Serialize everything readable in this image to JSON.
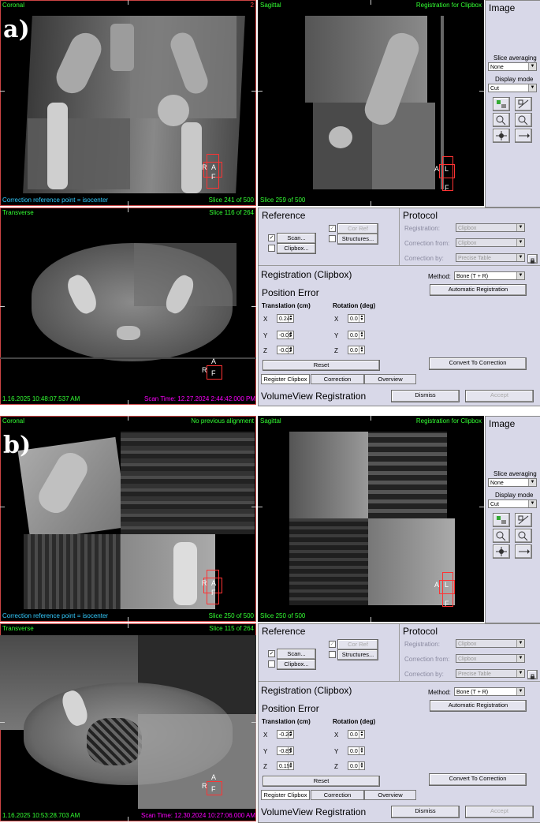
{
  "panels": [
    {
      "letter": "a)",
      "coronal": {
        "title": "Coronal",
        "right": "2",
        "bottom_left": "Correction reference point = isocenter",
        "bottom_right": "Slice 241 of 500"
      },
      "sagittal": {
        "title": "Sagittal",
        "right": "Registration for Clipbox",
        "bottom_left": "Slice 259 of 500"
      },
      "transverse": {
        "title": "Transverse",
        "right": "Slice 116 of 264",
        "bottom_left": "1.16.2025 10:48:07.537 AM",
        "bottom_right": "Scan Time: 12.27.2024 2:44:42.000 PM"
      },
      "translation": {
        "x": "0.24",
        "y": "-0.06",
        "z": "-0.03"
      },
      "rotation": {
        "x": "0.0",
        "y": "0.0",
        "z": "0.0"
      }
    },
    {
      "letter": "b)",
      "coronal": {
        "title": "Coronal",
        "right": "No previous alignment",
        "bottom_left": "Correction reference point = isocenter",
        "bottom_right": "Slice 250 of 500"
      },
      "sagittal": {
        "title": "Sagittal",
        "right": "Registration for Clipbox",
        "bottom_left": "Slice 250 of 500"
      },
      "transverse": {
        "title": "Transverse",
        "right": "Slice 115 of 264",
        "bottom_left": "1.16.2025 10:53:28.703 AM",
        "bottom_right": "Scan Time: 12.30.2024 10:27:06.000 AM"
      },
      "translation": {
        "x": "-0.20",
        "y": "-0.85",
        "z": "0.15"
      },
      "rotation": {
        "x": "0.0",
        "y": "0.0",
        "z": "0.0"
      }
    }
  ],
  "orient": {
    "coronal": [
      "R",
      "A",
      "F"
    ],
    "sagittal": [
      "A",
      "L",
      "F"
    ],
    "transverse": [
      "A",
      "R",
      "F"
    ]
  },
  "image_panel": {
    "title": "Image",
    "slice_avg_label": "Slice averaging",
    "slice_avg_value": "None",
    "display_mode_label": "Display mode",
    "display_mode_value": "Cut"
  },
  "reference": {
    "title": "Reference",
    "scan": "Scan...",
    "clipbox": "Clipbox...",
    "corref": "Cor Ref",
    "structures": "Structures..."
  },
  "protocol": {
    "title": "Protocol",
    "registration_label": "Registration:",
    "registration_value": "Clipbox",
    "correction_from_label": "Correction from:",
    "correction_from_value": "Clipbox",
    "correction_by_label": "Correction by:",
    "correction_by_value": "Precise Table"
  },
  "registration": {
    "title": "Registration (Clipbox)",
    "method_label": "Method:",
    "method_value": "Bone (T + R)",
    "auto_btn": "Automatic Registration",
    "position_error": "Position Error",
    "translation_label": "Translation (cm)",
    "rotation_label": "Rotation (deg)",
    "x": "X",
    "y": "Y",
    "z": "Z",
    "reset": "Reset",
    "convert": "Convert To Correction"
  },
  "tabs": [
    "Register Clipbox",
    "Correction",
    "Overview"
  ],
  "footer": {
    "title": "VolumeView Registration",
    "dismiss": "Dismiss",
    "accept": "Accept"
  }
}
